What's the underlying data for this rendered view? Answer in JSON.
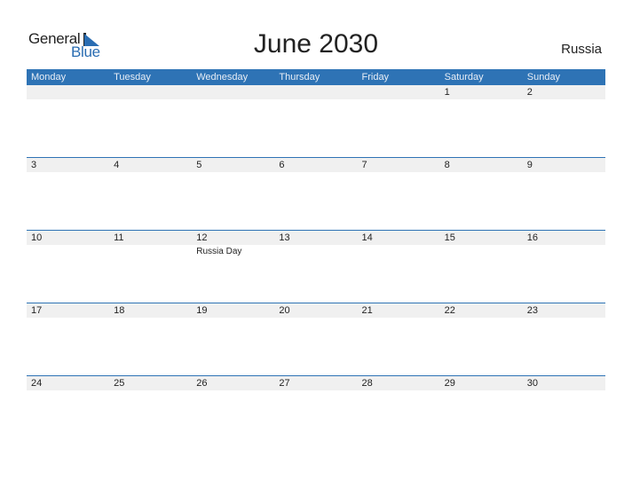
{
  "brand": {
    "line1": "General",
    "line2": "Blue"
  },
  "title": "June 2030",
  "country": "Russia",
  "weekdays": [
    "Monday",
    "Tuesday",
    "Wednesday",
    "Thursday",
    "Friday",
    "Saturday",
    "Sunday"
  ],
  "weeks": [
    {
      "days": [
        "",
        "",
        "",
        "",
        "",
        "1",
        "2"
      ],
      "events": [
        "",
        "",
        "",
        "",
        "",
        "",
        ""
      ]
    },
    {
      "days": [
        "3",
        "4",
        "5",
        "6",
        "7",
        "8",
        "9"
      ],
      "events": [
        "",
        "",
        "",
        "",
        "",
        "",
        ""
      ]
    },
    {
      "days": [
        "10",
        "11",
        "12",
        "13",
        "14",
        "15",
        "16"
      ],
      "events": [
        "",
        "",
        "Russia Day",
        "",
        "",
        "",
        ""
      ]
    },
    {
      "days": [
        "17",
        "18",
        "19",
        "20",
        "21",
        "22",
        "23"
      ],
      "events": [
        "",
        "",
        "",
        "",
        "",
        "",
        ""
      ]
    },
    {
      "days": [
        "24",
        "25",
        "26",
        "27",
        "28",
        "29",
        "30"
      ],
      "events": [
        "",
        "",
        "",
        "",
        "",
        "",
        ""
      ]
    }
  ],
  "colors": {
    "accent": "#2e73b5",
    "row_bg": "#f0f0f0"
  }
}
